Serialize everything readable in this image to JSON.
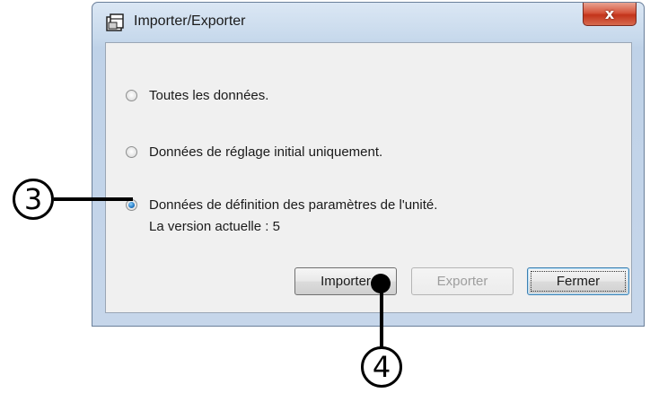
{
  "window": {
    "title": "Importer/Exporter",
    "close_label": "x",
    "icon": "folder-icon"
  },
  "options": [
    {
      "label": "Toutes les données.",
      "checked": false
    },
    {
      "label": "Données de réglage initial uniquement.",
      "checked": false
    },
    {
      "label": "Données de définition des paramètres de l'unité.",
      "checked": true
    }
  ],
  "version_text": "La version actuelle : 5",
  "buttons": {
    "import": "Importer",
    "export": "Exporter",
    "close": "Fermer"
  },
  "callouts": {
    "three": "3",
    "four": "4"
  },
  "colors": {
    "window_frame": "#c7d9ec",
    "client_bg": "#f0f0f0",
    "close_button": "#c3341b"
  }
}
